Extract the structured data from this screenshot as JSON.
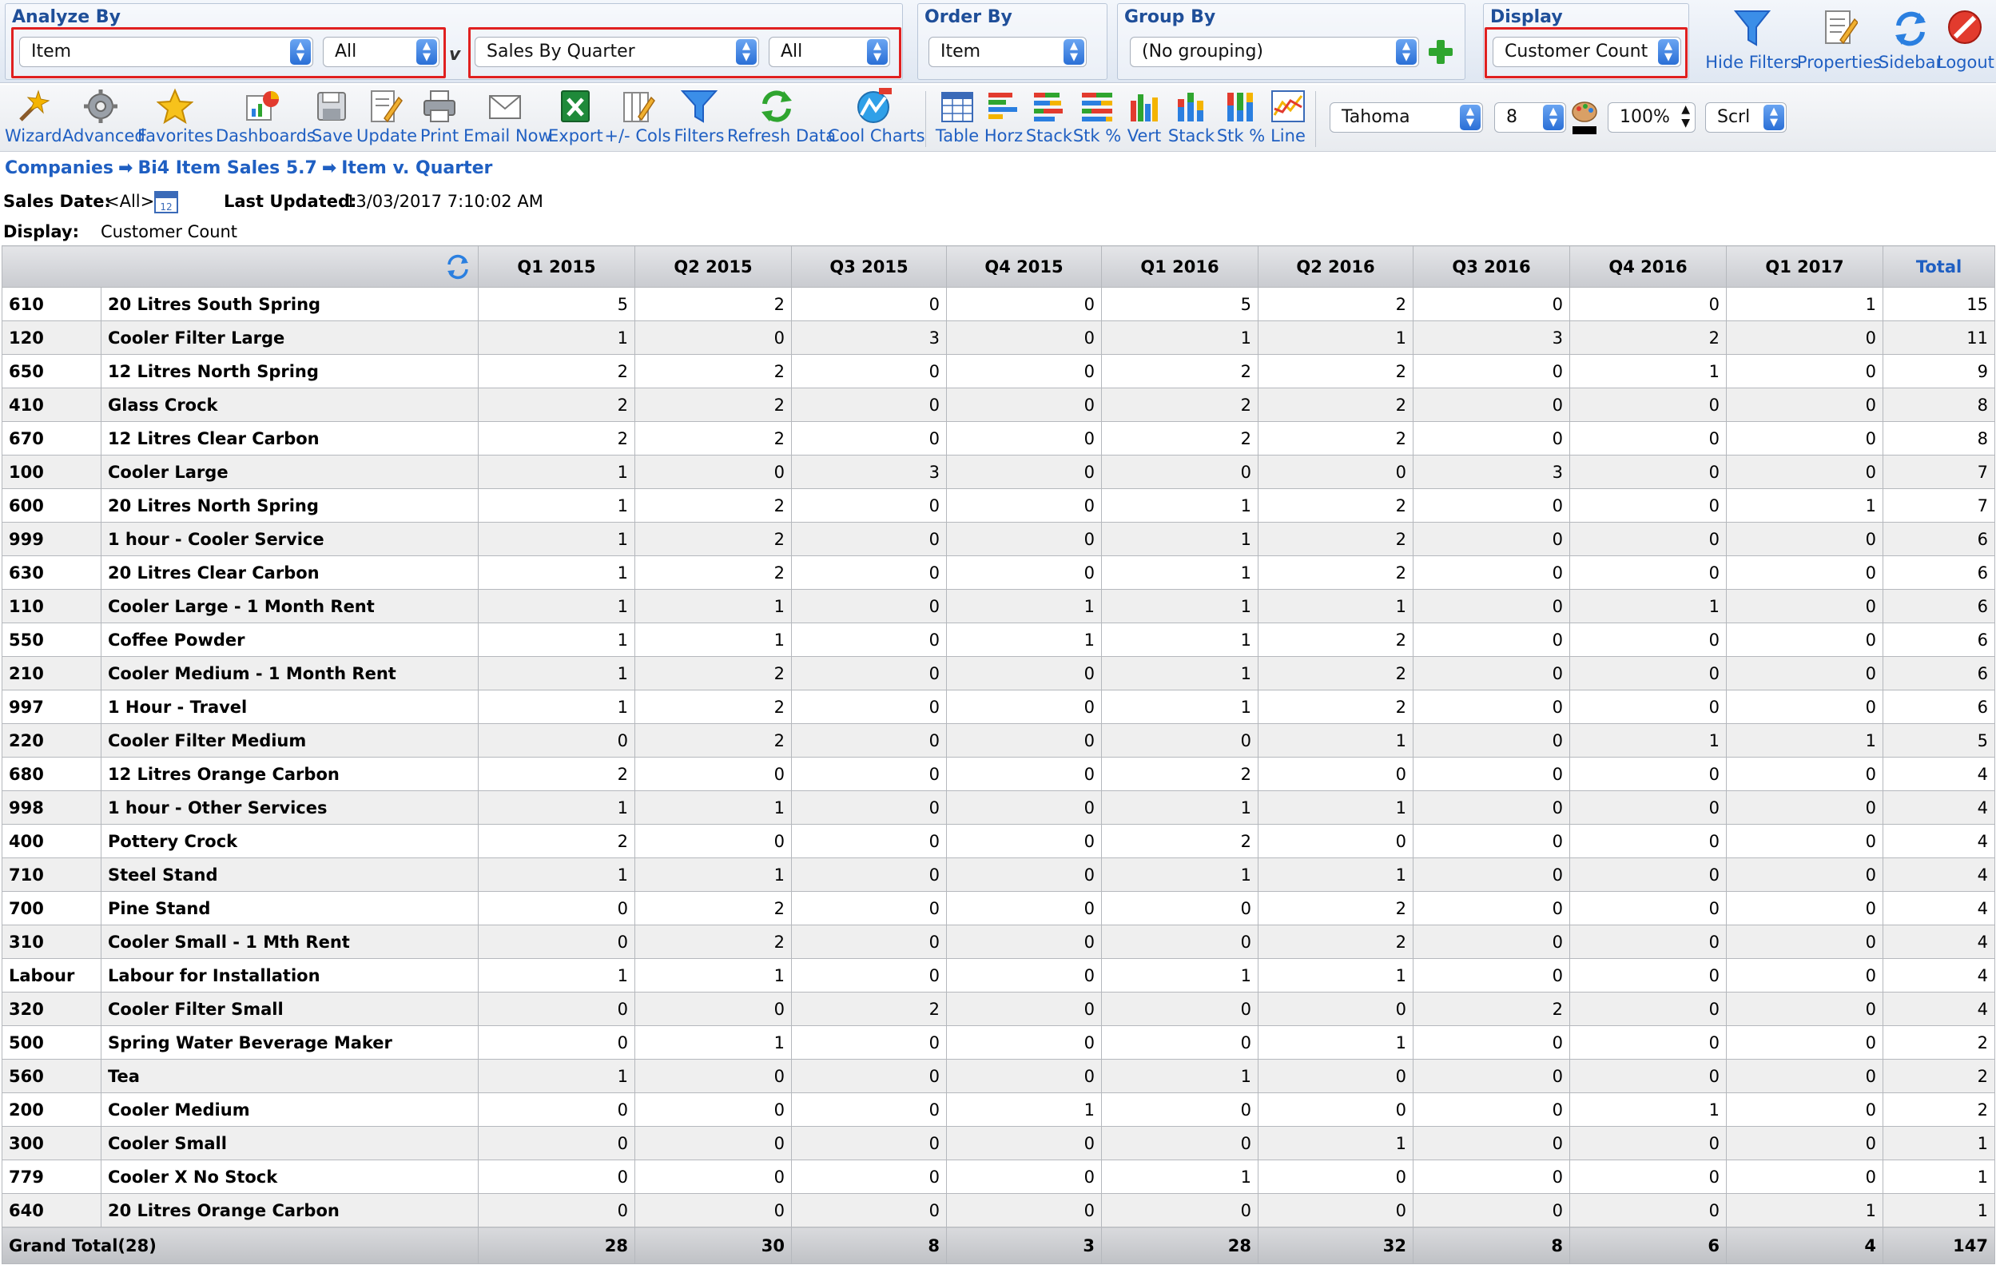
{
  "filters": {
    "analyze_by": {
      "title": "Analyze By",
      "primary": "Item",
      "primary_filter": "All",
      "separator": "v",
      "secondary": "Sales By Quarter",
      "secondary_filter": "All"
    },
    "order_by": {
      "title": "Order By",
      "value": "Item"
    },
    "group_by": {
      "title": "Group By",
      "value": "(No grouping)"
    },
    "display": {
      "title": "Display",
      "value": "Customer Count"
    }
  },
  "top_actions": {
    "hide_filters": "Hide Filters",
    "properties": "Properties",
    "sidebar": "Sidebar",
    "logout": "Logout"
  },
  "toolbar": {
    "wizard": "Wizard",
    "advanced": "Advanced",
    "favorites": "Favorites",
    "dashboards": "Dashboards",
    "save": "Save",
    "update": "Update",
    "print": "Print",
    "email_now": "Email Now",
    "export": "Export",
    "cols": "+/- Cols",
    "filters": "Filters",
    "refresh_data": "Refresh Data",
    "cool_charts": "Cool Charts",
    "table": "Table",
    "horz": "Horz",
    "stack": "Stack",
    "stk_pct": "Stk %",
    "vert": "Vert",
    "stack2": "Stack",
    "stk_pct2": "Stk %",
    "line": "Line",
    "font": "Tahoma",
    "font_size": "8",
    "zoom": "100%",
    "scroll": "Scrl"
  },
  "breadcrumb": {
    "companies": "Companies",
    "sep": "➡",
    "report": "Bi4 Item Sales 5.7",
    "view": "Item v. Quarter"
  },
  "meta": {
    "sales_date_label": "Sales Date:",
    "sales_date_value": "<All>",
    "last_updated_label": "Last Updated:",
    "last_updated_value": "13/03/2017 7:10:02 AM",
    "display_label": "Display:",
    "display_value": "Customer Count"
  },
  "table": {
    "columns": [
      "Q1 2015",
      "Q2 2015",
      "Q3 2015",
      "Q4 2015",
      "Q1 2016",
      "Q2 2016",
      "Q3 2016",
      "Q4 2016",
      "Q1 2017"
    ],
    "total_label": "Total",
    "rows": [
      {
        "code": "610",
        "name": "20 Litres South Spring",
        "values": [
          5,
          2,
          0,
          0,
          5,
          2,
          0,
          0,
          1
        ],
        "total": 15
      },
      {
        "code": "120",
        "name": "Cooler Filter Large",
        "values": [
          1,
          0,
          3,
          0,
          1,
          1,
          3,
          2,
          0
        ],
        "total": 11
      },
      {
        "code": "650",
        "name": "12 Litres North Spring",
        "values": [
          2,
          2,
          0,
          0,
          2,
          2,
          0,
          1,
          0
        ],
        "total": 9
      },
      {
        "code": "410",
        "name": "Glass Crock",
        "values": [
          2,
          2,
          0,
          0,
          2,
          2,
          0,
          0,
          0
        ],
        "total": 8
      },
      {
        "code": "670",
        "name": "12 Litres Clear Carbon",
        "values": [
          2,
          2,
          0,
          0,
          2,
          2,
          0,
          0,
          0
        ],
        "total": 8
      },
      {
        "code": "100",
        "name": "Cooler Large",
        "values": [
          1,
          0,
          3,
          0,
          0,
          0,
          3,
          0,
          0
        ],
        "total": 7
      },
      {
        "code": "600",
        "name": "20 Litres North Spring",
        "values": [
          1,
          2,
          0,
          0,
          1,
          2,
          0,
          0,
          1
        ],
        "total": 7
      },
      {
        "code": "999",
        "name": "1 hour - Cooler Service",
        "values": [
          1,
          2,
          0,
          0,
          1,
          2,
          0,
          0,
          0
        ],
        "total": 6
      },
      {
        "code": "630",
        "name": "20 Litres Clear Carbon",
        "values": [
          1,
          2,
          0,
          0,
          1,
          2,
          0,
          0,
          0
        ],
        "total": 6
      },
      {
        "code": "110",
        "name": "Cooler Large - 1 Month Rent",
        "values": [
          1,
          1,
          0,
          1,
          1,
          1,
          0,
          1,
          0
        ],
        "total": 6
      },
      {
        "code": "550",
        "name": "Coffee Powder",
        "values": [
          1,
          1,
          0,
          1,
          1,
          2,
          0,
          0,
          0
        ],
        "total": 6
      },
      {
        "code": "210",
        "name": "Cooler Medium - 1 Month Rent",
        "values": [
          1,
          2,
          0,
          0,
          1,
          2,
          0,
          0,
          0
        ],
        "total": 6
      },
      {
        "code": "997",
        "name": "1 Hour - Travel",
        "values": [
          1,
          2,
          0,
          0,
          1,
          2,
          0,
          0,
          0
        ],
        "total": 6
      },
      {
        "code": "220",
        "name": "Cooler Filter Medium",
        "values": [
          0,
          2,
          0,
          0,
          0,
          1,
          0,
          1,
          1
        ],
        "total": 5
      },
      {
        "code": "680",
        "name": "12 Litres Orange Carbon",
        "values": [
          2,
          0,
          0,
          0,
          2,
          0,
          0,
          0,
          0
        ],
        "total": 4
      },
      {
        "code": "998",
        "name": "1 hour - Other Services",
        "values": [
          1,
          1,
          0,
          0,
          1,
          1,
          0,
          0,
          0
        ],
        "total": 4
      },
      {
        "code": "400",
        "name": "Pottery Crock",
        "values": [
          2,
          0,
          0,
          0,
          2,
          0,
          0,
          0,
          0
        ],
        "total": 4
      },
      {
        "code": "710",
        "name": "Steel Stand",
        "values": [
          1,
          1,
          0,
          0,
          1,
          1,
          0,
          0,
          0
        ],
        "total": 4
      },
      {
        "code": "700",
        "name": "Pine Stand",
        "values": [
          0,
          2,
          0,
          0,
          0,
          2,
          0,
          0,
          0
        ],
        "total": 4
      },
      {
        "code": "310",
        "name": "Cooler Small - 1 Mth Rent",
        "values": [
          0,
          2,
          0,
          0,
          0,
          2,
          0,
          0,
          0
        ],
        "total": 4
      },
      {
        "code": "Labour",
        "name": "Labour for Installation",
        "values": [
          1,
          1,
          0,
          0,
          1,
          1,
          0,
          0,
          0
        ],
        "total": 4
      },
      {
        "code": "320",
        "name": "Cooler Filter Small",
        "values": [
          0,
          0,
          2,
          0,
          0,
          0,
          2,
          0,
          0
        ],
        "total": 4
      },
      {
        "code": "500",
        "name": "Spring Water Beverage Maker",
        "values": [
          0,
          1,
          0,
          0,
          0,
          1,
          0,
          0,
          0
        ],
        "total": 2
      },
      {
        "code": "560",
        "name": "Tea",
        "values": [
          1,
          0,
          0,
          0,
          1,
          0,
          0,
          0,
          0
        ],
        "total": 2
      },
      {
        "code": "200",
        "name": "Cooler Medium",
        "values": [
          0,
          0,
          0,
          1,
          0,
          0,
          0,
          1,
          0
        ],
        "total": 2
      },
      {
        "code": "300",
        "name": "Cooler Small",
        "values": [
          0,
          0,
          0,
          0,
          0,
          1,
          0,
          0,
          0
        ],
        "total": 1
      },
      {
        "code": "779",
        "name": "Cooler X No Stock",
        "values": [
          0,
          0,
          0,
          0,
          1,
          0,
          0,
          0,
          0
        ],
        "total": 1
      },
      {
        "code": "640",
        "name": "20 Litres Orange Carbon",
        "values": [
          0,
          0,
          0,
          0,
          0,
          0,
          0,
          0,
          1
        ],
        "total": 1
      }
    ],
    "grand_total_label": "Grand Total(28)",
    "grand_totals": [
      28,
      30,
      8,
      3,
      28,
      32,
      8,
      6,
      4
    ],
    "grand_total": 147
  },
  "colors": {
    "link": "#1f5fc2",
    "highlight_border": "#e02020",
    "header_bg": "#c9cbd0"
  }
}
